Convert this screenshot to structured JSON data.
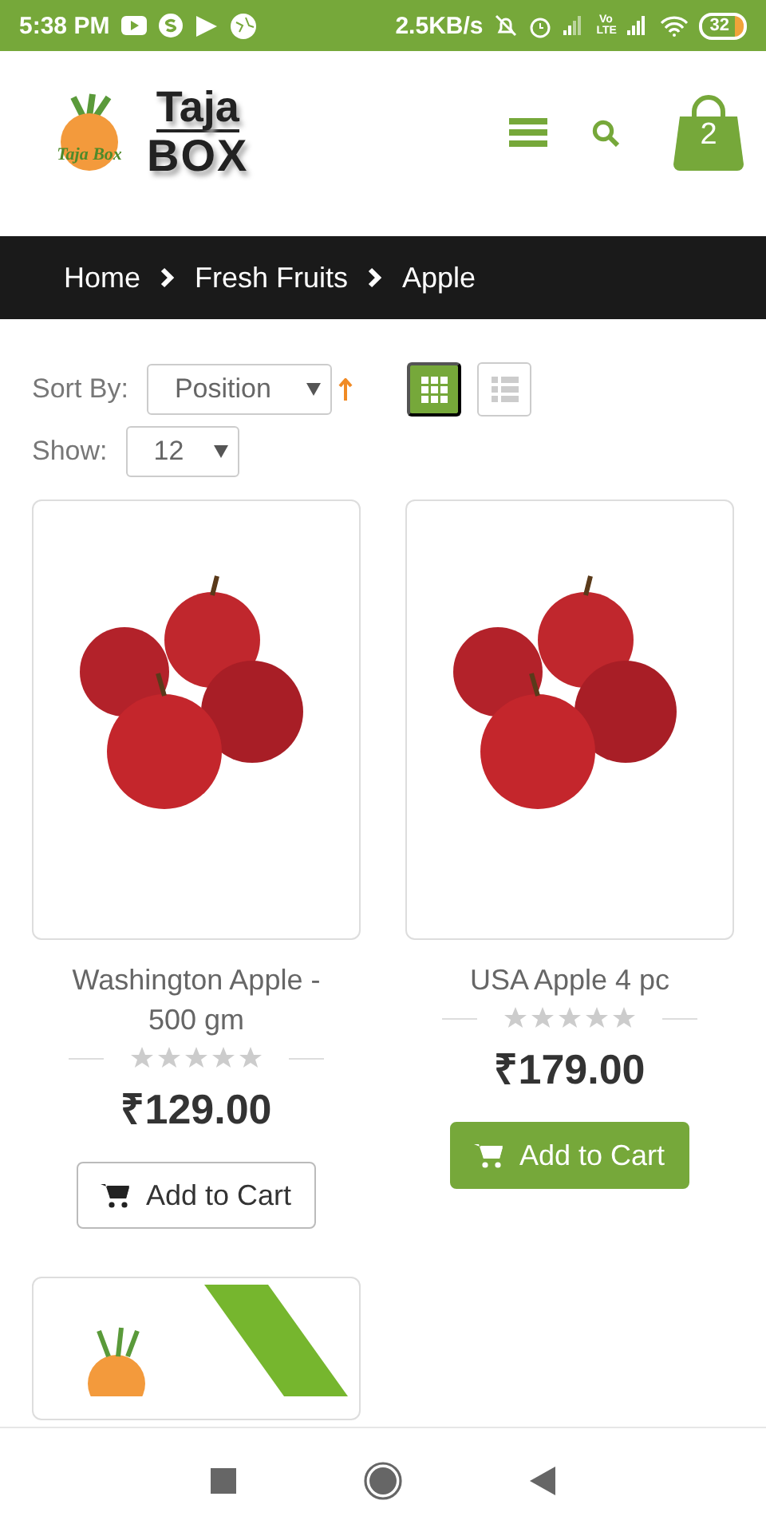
{
  "status_bar": {
    "time": "5:38 PM",
    "speed": "2.5KB/s",
    "network_label": "Vo LTE",
    "battery": "32"
  },
  "header": {
    "logo_badge": "Taja Box",
    "logo_top": "Taja",
    "logo_bottom": "BOX",
    "cart_count": "2"
  },
  "breadcrumb": [
    {
      "label": "Home"
    },
    {
      "label": "Fresh Fruits"
    },
    {
      "label": "Apple"
    }
  ],
  "toolbar": {
    "sort_label": "Sort By:",
    "sort_value": "Position",
    "show_label": "Show:",
    "show_value": "12",
    "view_modes": [
      {
        "kind": "grid",
        "selected": true
      },
      {
        "kind": "list",
        "selected": false
      }
    ]
  },
  "products": [
    {
      "kind": "apples",
      "name": "Washington Apple - 500 gm",
      "stars": 0,
      "price": "₹129.00",
      "button": {
        "label": "Add to Cart",
        "highlighted": false
      }
    },
    {
      "kind": "apples",
      "name": "USA Apple 4 pc",
      "stars": 0,
      "price": "₹179.00",
      "button": {
        "label": "Add to Cart",
        "highlighted": true
      }
    },
    {
      "kind": "logo"
    }
  ]
}
